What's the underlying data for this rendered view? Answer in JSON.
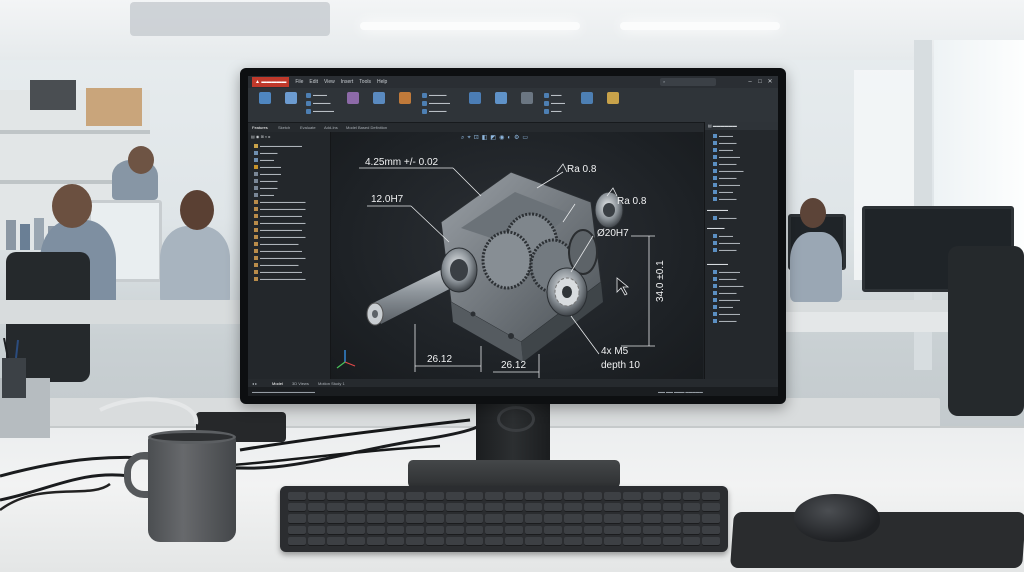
{
  "scene": {
    "description_colors": {
      "desk": "#eceeef",
      "monitor_bezel": "#0d0f11",
      "cad_background": "#1e2226",
      "accent": "#4d7fb3",
      "logo": "#c0392b"
    }
  },
  "cad": {
    "title": "",
    "menus": [
      "File",
      "Edit",
      "View",
      "Insert",
      "Tools",
      "Help"
    ],
    "window_controls": [
      "–",
      "□",
      "✕"
    ],
    "tabs": [
      "Features",
      "Sketch",
      "Evaluate",
      "Add-Ins",
      "Model Based Definition"
    ],
    "bottom_tabs": [
      "Model",
      "3D Views",
      "Motion Study 1"
    ],
    "annotations": {
      "dim_top": "4.25mm +/- 0.02",
      "dim_12": "12.0H7",
      "ra_top": "Ra 0.8",
      "ra_right": "Ra 0.8",
      "dia": "Ø20H7",
      "vertical": "34.0 ±0.1",
      "width_left": "26.12",
      "width_right": "26.12",
      "hole_line1": "4x M5",
      "hole_line2": "depth 10"
    }
  }
}
